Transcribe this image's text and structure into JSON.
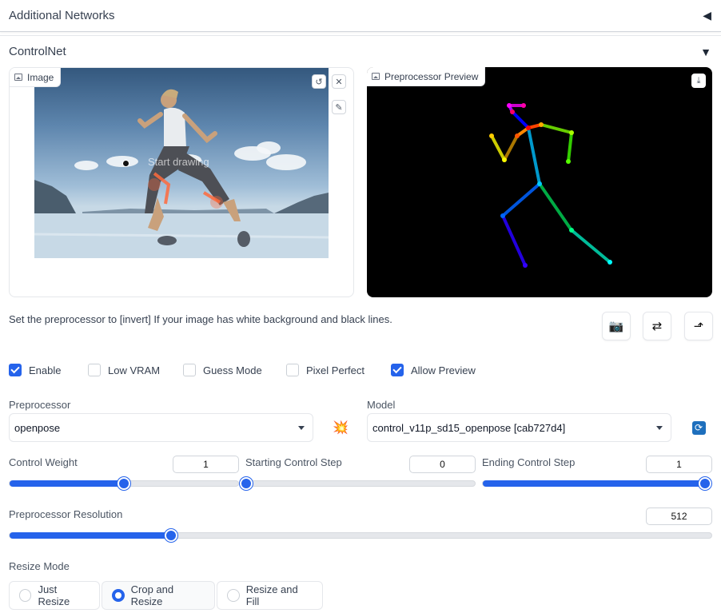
{
  "accordions": {
    "additional_networks": {
      "title": "Additional Networks",
      "arrow": "◀"
    },
    "controlnet": {
      "title": "ControlNet",
      "arrow": "▼"
    }
  },
  "image_panel": {
    "label": "Image",
    "draw_hint": "Start drawing"
  },
  "preview_panel": {
    "label": "Preprocessor Preview"
  },
  "hint_text": "Set the preprocessor to [invert] If your image has white background and black lines.",
  "action_buttons": [
    {
      "icon": "camera-icon",
      "glyph": "📷"
    },
    {
      "icon": "swap-icon",
      "glyph": "⇄"
    },
    {
      "icon": "send-arrow-icon",
      "glyph": "⬏"
    }
  ],
  "checkboxes": [
    {
      "label": "Enable",
      "checked": true
    },
    {
      "label": "Low VRAM",
      "checked": false
    },
    {
      "label": "Guess Mode",
      "checked": false
    },
    {
      "label": "Pixel Perfect",
      "checked": false
    },
    {
      "label": "Allow Preview",
      "checked": true
    }
  ],
  "preprocessor": {
    "label": "Preprocessor",
    "value": "openpose",
    "run_icon": "💥"
  },
  "model": {
    "label": "Model",
    "value": "control_v11p_sd15_openpose [cab727d4]",
    "refresh_icon": "🔄"
  },
  "sliders": {
    "control_weight": {
      "label": "Control Weight",
      "value": "1",
      "fraction": 0.5
    },
    "starting_step": {
      "label": "Starting Control Step",
      "value": "0",
      "fraction": 0.0
    },
    "ending_step": {
      "label": "Ending Control Step",
      "value": "1",
      "fraction": 1.0
    },
    "resolution": {
      "label": "Preprocessor Resolution",
      "value": "512",
      "fraction": 0.23
    }
  },
  "resize_mode": {
    "label": "Resize Mode",
    "options": [
      {
        "label": "Just Resize",
        "selected": false
      },
      {
        "label": "Crop and Resize",
        "selected": true
      },
      {
        "label": "Resize and Fill",
        "selected": false
      }
    ]
  },
  "colors": {
    "accent": "#2563eb",
    "preview_bg": "#000000"
  }
}
